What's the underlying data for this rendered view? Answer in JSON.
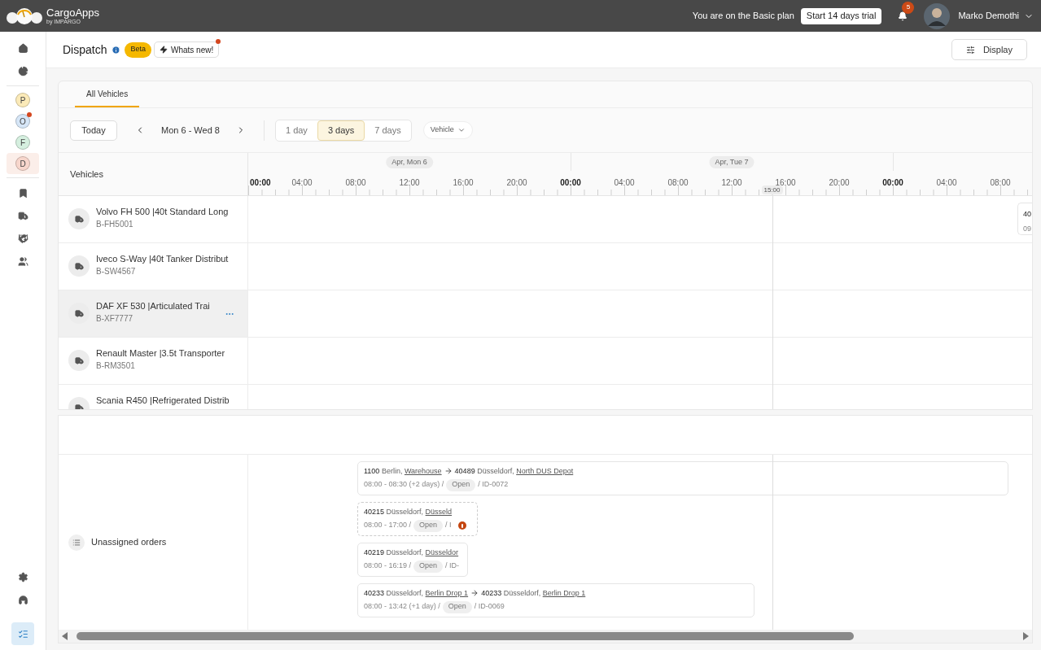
{
  "topbar": {
    "brand": "CargoApps",
    "brand_sub": "by IMPARGO",
    "plan_text": "You are on the Basic plan",
    "trial_button": "Start 14 days trial",
    "notifications": "5",
    "user": "Marko Demothi"
  },
  "sidebar": {
    "workspaces": [
      {
        "label": "P",
        "color": "#fbeab8",
        "selected": false,
        "notification": false
      },
      {
        "label": "O",
        "color": "#d6e6f7",
        "selected": false,
        "notification": true
      },
      {
        "label": "F",
        "color": "#d5efdf",
        "selected": false,
        "notification": false
      },
      {
        "label": "D",
        "color": "#f7d6cc",
        "selected": true,
        "notification": false
      }
    ],
    "panel_toggle": {
      "selected": true
    }
  },
  "header": {
    "title": "Dispatch",
    "badge": "Beta",
    "whats_new": "Whats new!",
    "whats_new_dot": true,
    "display_button": "Display"
  },
  "tabs": [
    {
      "label": "All Vehicles",
      "selected": true
    }
  ],
  "toolbar": {
    "today": "Today",
    "date_range": "Mon 6 - Wed 8",
    "ranges": [
      {
        "label": "1 day",
        "selected": false
      },
      {
        "label": "3 days",
        "selected": true
      },
      {
        "label": "7 days",
        "selected": false
      }
    ],
    "group_by": "Vehicle"
  },
  "timeline": {
    "column_title": "Vehicles",
    "days": [
      {
        "label": "Apr, Mon 6"
      },
      {
        "label": "Apr, Tue 7"
      }
    ],
    "hours": [
      {
        "label": "00:00",
        "kind": "midnight"
      },
      {
        "label": "04:00",
        "kind": "hour"
      },
      {
        "label": "08:00",
        "kind": "hour"
      },
      {
        "label": "12:00",
        "kind": "hour"
      },
      {
        "label": "16:00",
        "kind": "hour"
      },
      {
        "label": "20:00",
        "kind": "hour"
      },
      {
        "label": "00:00",
        "kind": "midnight"
      },
      {
        "label": "04:00",
        "kind": "hour"
      },
      {
        "label": "08:00",
        "kind": "hour"
      },
      {
        "label": "12:00",
        "kind": "hour"
      },
      {
        "label": "16:00",
        "kind": "hour"
      },
      {
        "label": "20:00",
        "kind": "hour"
      },
      {
        "label": "00:00",
        "kind": "midnight"
      },
      {
        "label": "04:00",
        "kind": "hour"
      },
      {
        "label": "08:00",
        "kind": "hour"
      }
    ],
    "now": "15:00"
  },
  "vehicles": [
    {
      "name": "Volvo FH 500 |40t Standard Long",
      "plate": "B-FH5001",
      "selected": false,
      "orders": [
        {
          "line1": "40",
          "line2": "09"
        }
      ]
    },
    {
      "name": "Iveco S-Way |40t Tanker Distribut",
      "plate": "B-SW4567",
      "selected": false
    },
    {
      "name": "DAF XF 530 |Articulated Trai",
      "plate": "B-XF7777",
      "selected": true
    },
    {
      "name": "Renault Master |3.5t Transporter",
      "plate": "B-RM3501",
      "selected": false
    },
    {
      "name": "Scania R450 |Refrigerated Distrib",
      "selected": false
    }
  ],
  "unassigned": {
    "label": "Unassigned orders",
    "orders": [
      {
        "from_zip": "1100",
        "from_city": "Berlin,",
        "from_place": "Warehouse",
        "to_zip": "40489",
        "to_city": "Düsseldorf,",
        "to_place": "North DUS Depot",
        "time": "08:00 - 08:30 (+2 days) /",
        "status": "Open",
        "id": "/ ID-0072",
        "dashed": false,
        "warning": false
      },
      {
        "from_zip": "40215",
        "from_city": "Düsseldorf,",
        "from_place": "Düsseld",
        "time": "08:00 - 17:00 /",
        "status": "Open",
        "id": "/ I",
        "dashed": true,
        "warning": true
      },
      {
        "from_zip": "40219",
        "from_city": "Düsseldorf,",
        "from_place": "Düsseldor",
        "time": "08:00 - 16:19 /",
        "status": "Open",
        "id": "/ ID-",
        "dashed": false,
        "warning": false
      },
      {
        "from_zip": "40233",
        "from_city": "Düsseldorf,",
        "from_place": "Berlin Drop 1",
        "to_zip": "40233",
        "to_city": "Düsseldorf,",
        "to_place": "Berlin Drop 1",
        "time": "08:00 - 13:42 (+1 day) /",
        "status": "Open",
        "id": "/ ID-0069",
        "dashed": false,
        "warning": false
      }
    ]
  }
}
